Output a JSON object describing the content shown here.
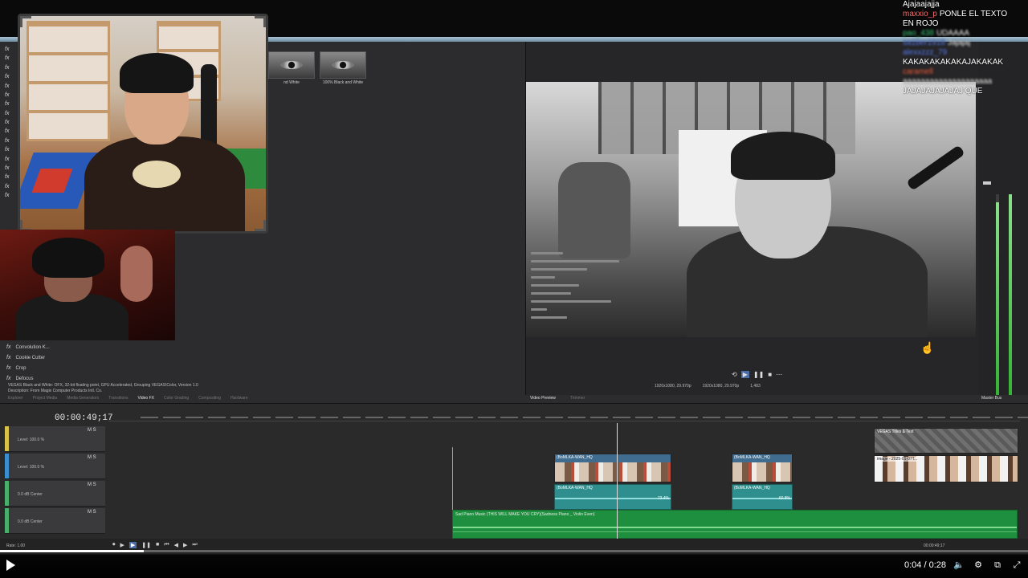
{
  "app": {
    "fx_labels": [
      "fx",
      "fx",
      "fx",
      "fx",
      "fx",
      "fx",
      "fx",
      "fx",
      "fx",
      "fx",
      "fx",
      "fx",
      "fx",
      "fx",
      "fx",
      "fx",
      "fx"
    ],
    "thumbs": [
      {
        "caption": "nd White"
      },
      {
        "caption": "100% Black and White"
      }
    ],
    "plugins": [
      {
        "fx": "fx",
        "name": "Convolution K..."
      },
      {
        "fx": "fx",
        "name": "Cookie Cutter"
      },
      {
        "fx": "fx",
        "name": "Crop"
      },
      {
        "fx": "fx",
        "name": "Defocus"
      }
    ],
    "plugin_description_1": "VEGAS Black and White: OFX, 32-bit floating point, GPU Accelerated, Grouping VEGAS\\Color, Version 1.0",
    "plugin_description_2": "Description: From Magix Computer Products Intl. Co.",
    "tabs_left": [
      {
        "label": "Explorer",
        "active": false
      },
      {
        "label": "Project Media",
        "active": false
      },
      {
        "label": "Media Generators",
        "active": false
      },
      {
        "label": "Transitions",
        "active": false
      },
      {
        "label": "Video FX",
        "active": true
      },
      {
        "label": "Color Grading",
        "active": false
      },
      {
        "label": "Compositing",
        "active": false
      },
      {
        "label": "Hardware",
        "active": false
      }
    ],
    "tabs_right": [
      {
        "label": "Video Preview",
        "active": true
      },
      {
        "label": "Trimmer",
        "active": false
      }
    ],
    "master_bus": "Master Bus",
    "preview": {
      "controls": [
        "⟲",
        "▶",
        "❚❚",
        "■",
        "⋯"
      ],
      "info": [
        "1920x1080, 29.970p",
        "1920x1080, 29.970p",
        "1,483",
        ""
      ]
    },
    "timeline": {
      "time_code": "00:00:49;17",
      "tracks": [
        {
          "level": "Level: 100.0 %",
          "ms": "M  S",
          "color": "#d9c24a"
        },
        {
          "level": "Level: 100.0 %",
          "ms": "M  S",
          "color": "#3a8fd0"
        },
        {
          "level": "0.0 dB        Center",
          "ms": "M  S",
          "color": "#48b06a"
        },
        {
          "level": "0.0 dB        Center",
          "ms": "M  S",
          "color": "#48b06a"
        }
      ],
      "clip1_caption": "(BoMLKA-WAN_HQ",
      "clip1_audio_caption": "(BoMLKA-WAN_HQ",
      "clip2_caption": "(BoMLKA-WAN_HQ",
      "clip2_audio_caption": "(BoMLKA-WAN_HQ",
      "clip1_level": "73.4%",
      "clip2_level": "60.8%",
      "title_caption": "VEGAS Titles & Text",
      "image_caption": "image - 2025-01-07T...",
      "music_caption": "Sad Piano Music (THIS WILL MAKE YOU CRY)(Sadness Piano _ Violin Even)",
      "rate": "Rate: 1.00",
      "transport": [
        "⏺",
        "▶",
        "▶",
        "❚❚",
        "■",
        "⏮",
        "◀",
        "▶",
        "⏭"
      ],
      "end_time": "00:00:49;17"
    }
  },
  "chat": [
    {
      "user": "",
      "text": "Ajajaajajja",
      "color": "#ffffff",
      "blur": false
    },
    {
      "user": "maxxio_p",
      "text": "PONLE EL TEXTO",
      "color": "#ff6a6a",
      "blur": false
    },
    {
      "user": "",
      "text": "EN ROJO",
      "color": "#ffffff",
      "blur": false
    },
    {
      "user": "pao_438",
      "text": "UDAAAA",
      "color": "#40d080",
      "blur": true
    },
    {
      "user": "sa1ber1918",
      "text": "Jajajaj",
      "color": "#6a8cff",
      "blur": true
    },
    {
      "user": "alexxzzz_79",
      "text": "",
      "color": "#6a8cff",
      "blur": true
    },
    {
      "user": "",
      "text": "KAKAKAKAKAKAJAKAKAK",
      "color": "#ffffff",
      "blur": false
    },
    {
      "user": "caramell",
      "text": "",
      "color": "#ff6a4a",
      "blur": true
    },
    {
      "user": "",
      "text": "aaaaaaaaaaaaaaaaaaaa",
      "color": "#ffffff",
      "blur": true
    },
    {
      "user": "",
      "text": "",
      "color": "#40d080",
      "blur": true
    },
    {
      "user": "",
      "text": "JAJAJAJAJAJAJ QUE",
      "color": "#ffffff",
      "blur": false
    }
  ],
  "player": {
    "time": "0:04 / 0:28",
    "progress": 0.14
  },
  "colors": {
    "accent": "#4c6ea8",
    "music_track": "#1e8f3e",
    "video_clip": "#3f6c8f",
    "audio_clip": "#2f8f8f"
  }
}
